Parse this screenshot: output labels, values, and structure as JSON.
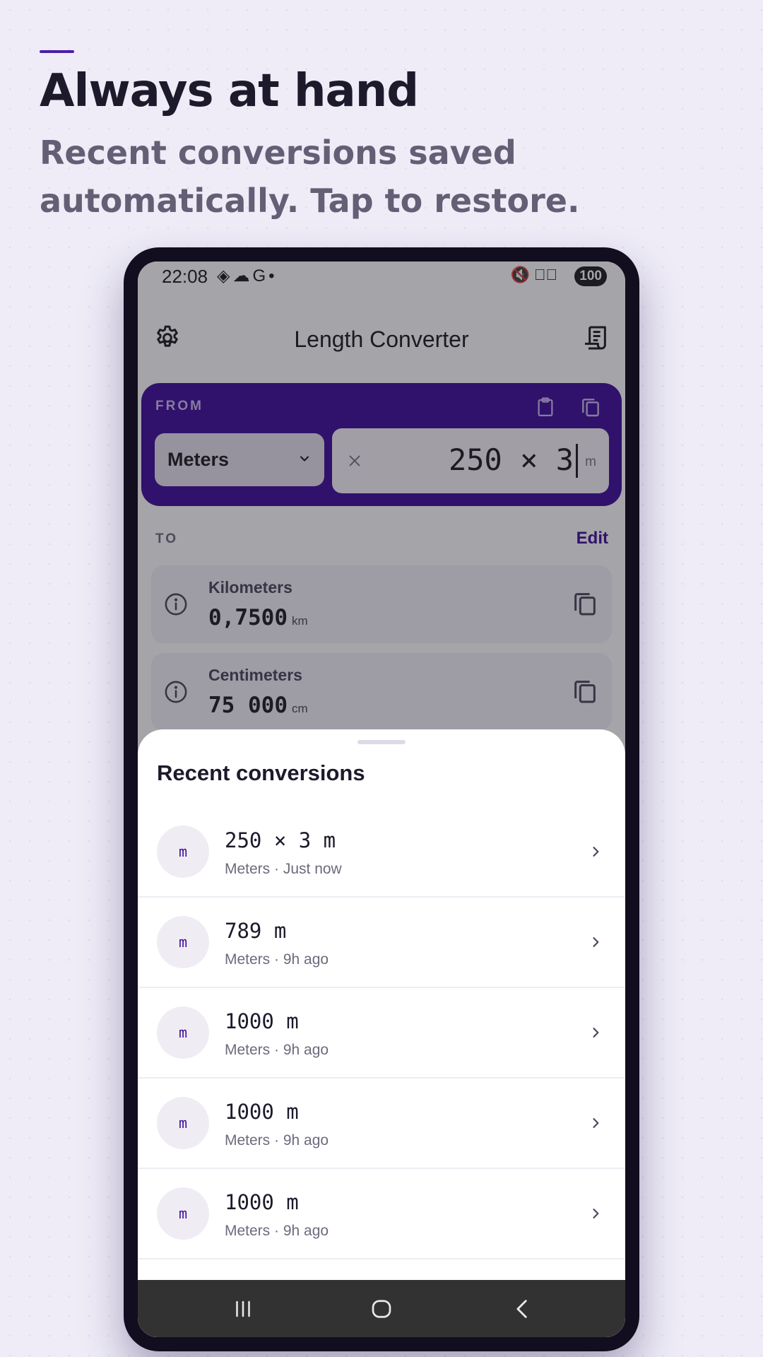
{
  "promo": {
    "headline": "Always at hand",
    "subheadline": "Recent conversions saved automatically. Tap to restore."
  },
  "status_bar": {
    "time": "22:08",
    "left_icons": "◈☁G•",
    "right_icons": "🔇≋⃠",
    "battery": "100"
  },
  "app": {
    "title": "Length Converter",
    "settings_icon": "gear-icon",
    "history_icon": "history-icon"
  },
  "from": {
    "label": "FROM",
    "unit": "Meters",
    "value": "250 × 3",
    "unit_symbol": "m",
    "clear_glyph": "×"
  },
  "to": {
    "label": "TO",
    "edit_label": "Edit",
    "results": [
      {
        "name": "Kilometers",
        "value": "0,7500",
        "unit": "km"
      },
      {
        "name": "Centimeters",
        "value": "75 000",
        "unit": "cm"
      }
    ]
  },
  "sheet": {
    "title": "Recent conversions",
    "items": [
      {
        "avatar": "m",
        "expr": "250 × 3 m",
        "meta": "Meters · Just now"
      },
      {
        "avatar": "m",
        "expr": "789 m",
        "meta": "Meters · 9h ago"
      },
      {
        "avatar": "m",
        "expr": "1000 m",
        "meta": "Meters · 9h ago"
      },
      {
        "avatar": "m",
        "expr": "1000 m",
        "meta": "Meters · 9h ago"
      },
      {
        "avatar": "m",
        "expr": "1000 m",
        "meta": "Meters · 9h ago"
      }
    ]
  },
  "colors": {
    "accent": "#3d0c9c",
    "background": "#efecf8",
    "scrim": "rgba(30,28,38,0.40)"
  }
}
